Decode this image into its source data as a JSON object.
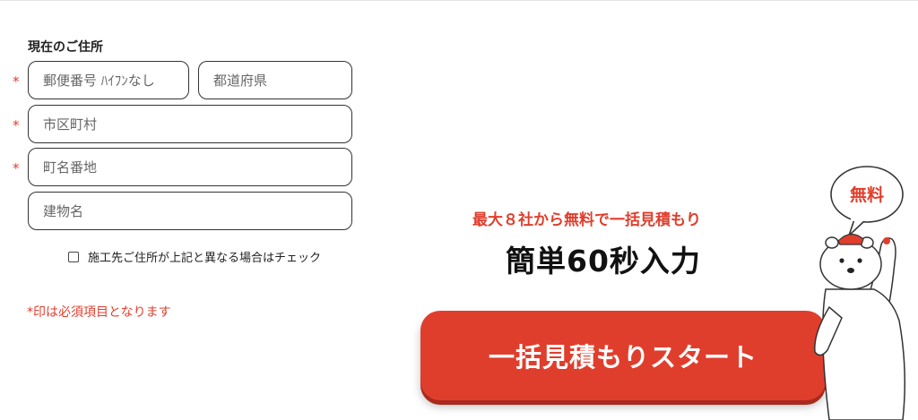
{
  "address_form": {
    "title": "現在のご住所",
    "required_mark": "*",
    "postal_code": {
      "placeholder": "郵便番号 ﾊｲﾌﾝなし"
    },
    "prefecture": {
      "placeholder": "都道府県"
    },
    "city": {
      "placeholder": "市区町村"
    },
    "street": {
      "placeholder": "町名番地"
    },
    "building": {
      "placeholder": "建物名"
    },
    "different_site_checkbox": {
      "label": "施工先ご住所が上記と異なる場合はチェック",
      "checked": false
    },
    "required_note": "*印は必須項目となります"
  },
  "promo": {
    "subline": "最大８社から無料で一括見積もり",
    "headline": "簡単60秒入力",
    "cta_label": "一括見積もりスタート",
    "badge_text": "無料"
  },
  "colors": {
    "accent": "#e03e2d",
    "text": "#222222",
    "field_border": "#333333"
  }
}
